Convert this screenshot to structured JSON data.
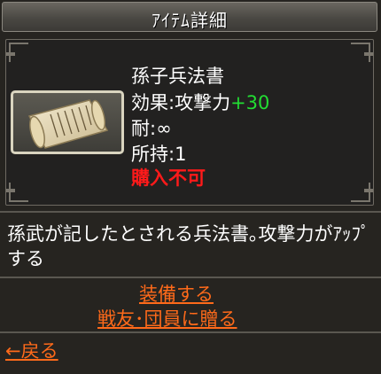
{
  "window": {
    "title": "ｱｲﾃﾑ詳細"
  },
  "item": {
    "name": "孫子兵法書",
    "effect_label": "効果:攻撃力",
    "effect_bonus": "+30",
    "durability": "耐:∞",
    "owned": "所持:1",
    "purchase_status": "購入不可",
    "icon": "scroll-icon",
    "description": "孫武が記したとされる兵法書｡攻撃力がｱｯﾌﾟする"
  },
  "actions": {
    "equip": "装備する",
    "gift": "戦友･団員に贈る",
    "back": "←戻る"
  },
  "colors": {
    "bonus": "#22dd33",
    "status": "#ff1a1a",
    "link": "#ff6a1a"
  }
}
